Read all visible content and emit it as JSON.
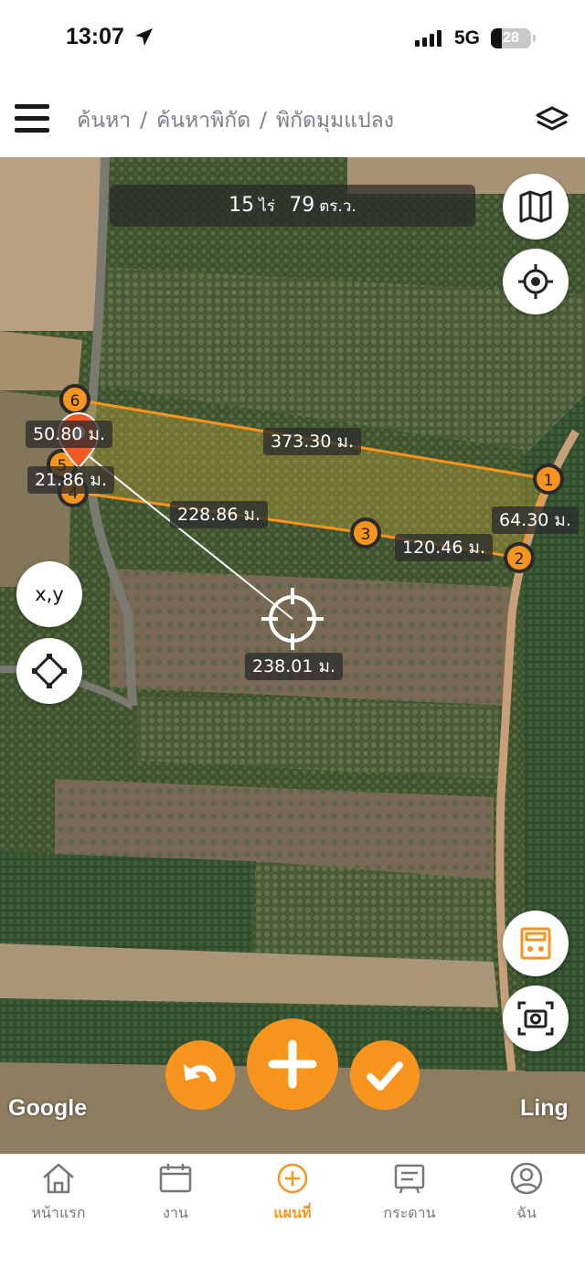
{
  "status_bar": {
    "time": "13:07",
    "network": "5G",
    "battery": "28"
  },
  "header": {
    "breadcrumb": [
      "ค้นหา",
      "ค้นหาพิกัด",
      "พิกัดมุมแปลง"
    ],
    "separator": "/"
  },
  "map": {
    "area": {
      "rai": "15",
      "rai_unit": "ไร่",
      "sqwa": "79",
      "sqwa_unit": "ตร.ว."
    },
    "points": [
      "1",
      "2",
      "3",
      "4",
      "5",
      "6"
    ],
    "measurements": {
      "side_6_1": "373.30 ม.",
      "side_1_2": "64.30 ม.",
      "side_2_3": "120.46 ม.",
      "side_3_4": "228.86 ม.",
      "side_5_6": "50.80 ม.",
      "side_4_5": "21.86 ม.",
      "crosshair_distance": "238.01 ม."
    },
    "xy_button": "x,y",
    "attribution_left": "Google",
    "attribution_right": "Ling"
  },
  "icons": {
    "map_type": "map-icon",
    "locate": "target-icon",
    "layers": "layers-icon",
    "calculator": "calculator-icon",
    "screenshot": "camera-icon",
    "undo": "undo-icon",
    "add": "plus-icon",
    "confirm": "check-icon"
  },
  "tabs": [
    {
      "label": "หน้าแรก",
      "icon": "home-icon",
      "active": false
    },
    {
      "label": "งาน",
      "icon": "calendar-icon",
      "active": false
    },
    {
      "label": "แผนที่",
      "icon": "add-circle-icon",
      "active": true
    },
    {
      "label": "กระดาน",
      "icon": "board-icon",
      "active": false
    },
    {
      "label": "ฉัน",
      "icon": "user-icon",
      "active": false
    }
  ],
  "colors": {
    "accent": "#f7941d",
    "text_muted": "#7d7f86"
  }
}
